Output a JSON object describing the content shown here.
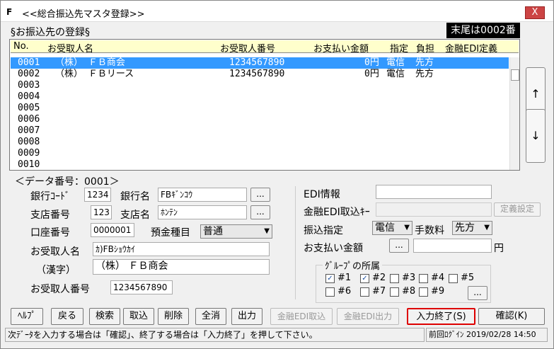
{
  "window": {
    "title": "<<総合振込先マスタ登録>>",
    "close_label": "X"
  },
  "header": {
    "title": "§お振込先の登録§",
    "last_number": "末尾は0002番"
  },
  "columns": [
    "No.",
    "お受取人名",
    "お受取人番号",
    "お支払い金額",
    "指定",
    "負担",
    "金融EDI定義"
  ],
  "rows": [
    {
      "no": "0001",
      "name": "（株） ＦＢ商会",
      "number": "1234567890",
      "amount": "0円",
      "shitei": "電信",
      "futan": "先方",
      "selected": true
    },
    {
      "no": "0002",
      "name": "（株） ＦＢリース",
      "number": "1234567890",
      "amount": "0円",
      "shitei": "電信",
      "futan": "先方"
    },
    {
      "no": "0003"
    },
    {
      "no": "0004"
    },
    {
      "no": "0005"
    },
    {
      "no": "0006"
    },
    {
      "no": "0007"
    },
    {
      "no": "0008"
    },
    {
      "no": "0009"
    },
    {
      "no": "0010"
    }
  ],
  "scroll": {
    "up": "↑",
    "down": "↓"
  },
  "form": {
    "data_number": "＜データ番号：0001＞",
    "bank_code_label": "銀行ｺｰﾄﾞ",
    "bank_code": "1234",
    "bank_name_label": "銀行名",
    "bank_name": "FBｷﾞﾝｺｳ",
    "branch_no_label": "支店番号",
    "branch_no": "123",
    "branch_name_label": "支店名",
    "branch_name": "ﾎﾝﾃﾝ",
    "account_label": "口座番号",
    "account": "0000001",
    "deposit_label": "預金種目",
    "deposit": "普通",
    "payee_label": "お受取人名",
    "payee_kana": "ｶ)FBｼｮｳｶｲ",
    "kanji_label": "（漢字）",
    "payee_kanji": "（株） ＦＢ商会",
    "payee_no_label": "お受取人番号",
    "payee_no": "1234567890",
    "edi_label": "EDI情報",
    "edi_value": "",
    "edi_key_label": "金融EDI取込ｷｰ",
    "edi_key_value": "",
    "define_btn": "定義設定",
    "transfer_label": "振込指定",
    "transfer": "電信",
    "fee_label": "手数料",
    "fee": "先方",
    "amount_label": "お支払い金額",
    "amount": "",
    "yen": "円",
    "dots": "...",
    "group_label": "ｸﾞﾙｰﾌﾟの所属",
    "groups": [
      {
        "label": "#1",
        "checked": true
      },
      {
        "label": "#2",
        "checked": true
      },
      {
        "label": "#3",
        "checked": false
      },
      {
        "label": "#4",
        "checked": false
      },
      {
        "label": "#5",
        "checked": false
      },
      {
        "label": "#6",
        "checked": false
      },
      {
        "label": "#7",
        "checked": false
      },
      {
        "label": "#8",
        "checked": false
      },
      {
        "label": "#9",
        "checked": false
      }
    ]
  },
  "buttons": {
    "help": "ﾍﾙﾌﾟ",
    "back": "戻る",
    "search": "検索",
    "import": "取込",
    "delete": "削除",
    "clear": "全消",
    "output": "出力",
    "edi_import": "金融EDI取込",
    "edi_output": "金融EDI出力",
    "finish": "入力終了(S)",
    "confirm": "確認(K)"
  },
  "status": {
    "message": "次ﾃﾞｰﾀを入力する場合は「確認」、終了する場合は「入力終了」を押して下さい。",
    "last_login": "前回ﾛｸﾞｲﾝ 2019/02/28 14:50"
  },
  "colors": {
    "selection": "#3399ff",
    "header_bg": "#ffffcc",
    "highlight": "#dd0000"
  }
}
